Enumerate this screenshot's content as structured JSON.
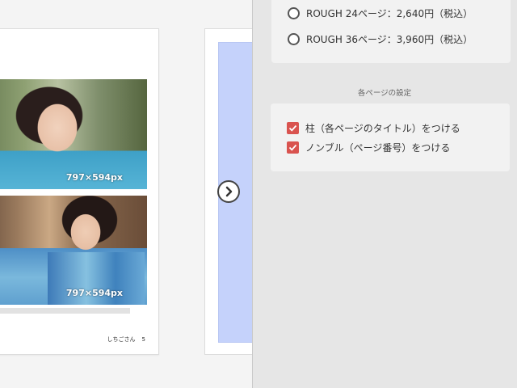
{
  "preview": {
    "photos": [
      {
        "size_label": "797×594px"
      },
      {
        "size_label": "797×594px"
      }
    ],
    "footer": {
      "title": "しちごさん",
      "page_number": "5"
    },
    "next_icon": "chevron-right-icon"
  },
  "panel": {
    "options": [
      {
        "label": "ROUGH 24ページ：2,640円（税込）",
        "selected": false
      },
      {
        "label": "ROUGH 36ページ：3,960円（税込）",
        "selected": false
      }
    ],
    "section_title": "各ページの設定",
    "checkboxes": [
      {
        "label": "柱（各ページのタイトル）をつける",
        "checked": true
      },
      {
        "label": "ノンブル（ページ番号）をつける",
        "checked": true
      }
    ],
    "accent_color": "#d9534f"
  }
}
